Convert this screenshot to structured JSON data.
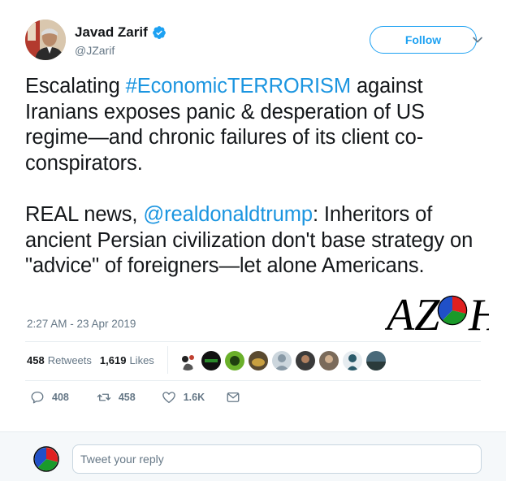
{
  "author": {
    "name": "Javad Zarif",
    "handle": "@JZarif",
    "verified": true,
    "avatar_icon": "profile-photo"
  },
  "follow_label": "Follow",
  "tweet": {
    "seg1": "Escalating ",
    "hashtag": "#EconomicTERRORISM",
    "seg2": " against Iranians exposes panic & desperation of US regime—and chronic failures of its client co-conspirators.\n\nREAL news, ",
    "mention": "@realdonaldtrump",
    "seg3": ": Inheritors of ancient Persian civilization don't base strategy on \"advice\" of foreigners—let alone Americans."
  },
  "timestamp": "2:27 AM - 23 Apr 2019",
  "stats": {
    "retweets_count": "458",
    "retweets_label": "Retweets",
    "likes_count": "1,619",
    "likes_label": "Likes"
  },
  "actions": {
    "replies": "408",
    "retweets": "458",
    "likes": "1.6K"
  },
  "reply": {
    "placeholder": "Tweet your reply"
  },
  "watermark": {
    "text": "AZOH"
  },
  "colors": {
    "accent": "#1da1f2",
    "link": "#1b95e0",
    "muted": "#657786"
  }
}
